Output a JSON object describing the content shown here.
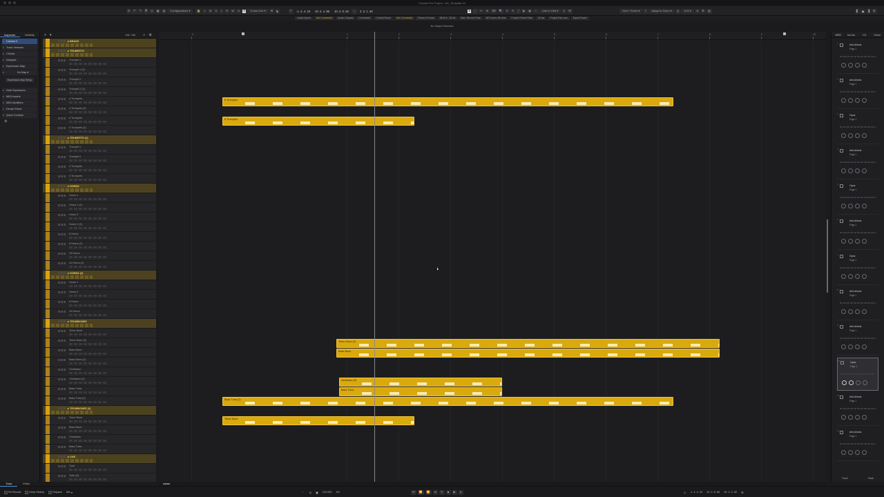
{
  "window": {
    "title": "Cubase Pro Project - AG_Template 04"
  },
  "toolbar": {
    "configurations_label": "Configurations",
    "crossfade_label": "Cross-Ove",
    "position_left": "-1. 4. 4. 23",
    "position_mid": "10. 2. 4. 85",
    "position_end": "10. 2. 0. 62",
    "length": "2. 3. 1. 40",
    "snap_label": "Link to Grid",
    "grid_label": "Grid + Event",
    "zoom_label": "Adapt to Zoom",
    "quantize": "1/16"
  },
  "status": {
    "items": [
      {
        "label": "Audio Inputs",
        "warn": false
      },
      {
        "label": "Not Connected",
        "warn": true
      },
      {
        "label": "Audio Outputs",
        "warn": false
      },
      {
        "label": "Connected",
        "warn": false
      },
      {
        "label": "Control Room",
        "warn": false
      },
      {
        "label": "Not Connected",
        "warn": true
      },
      {
        "label": "Record Format",
        "warn": false
      },
      {
        "label": "48 kHz - 32 bit",
        "warn": false
      },
      {
        "label": "Max. Record Time",
        "warn": false
      },
      {
        "label": "687 hours 48 mins",
        "warn": false
      },
      {
        "label": "Project Frame Rate",
        "warn": false
      },
      {
        "label": "30 fps",
        "warn": false
      },
      {
        "label": "Project Pan Law",
        "warn": false
      },
      {
        "label": "Equal Power",
        "warn": false
      }
    ],
    "info_line": "No Object Selected"
  },
  "inspector": {
    "tabs": [
      "Inspector",
      "Visibility"
    ],
    "sections": [
      {
        "label": "Clarinet 3",
        "highlight": true
      },
      {
        "label": "Track Versions",
        "highlight": false
      },
      {
        "label": "Chords",
        "highlight": false
      },
      {
        "label": "Notepad",
        "highlight": false
      },
      {
        "label": "Expression Map",
        "highlight": false
      }
    ],
    "no_map": "No Map",
    "setup_button": "Expression Map Setup",
    "sections2": [
      {
        "label": "Note Expression"
      },
      {
        "label": "MIDI Inserts"
      },
      {
        "label": "MIDI Modifiers"
      },
      {
        "label": "Device Panel"
      },
      {
        "label": "Quick Controls"
      }
    ]
  },
  "tracklist": {
    "count": "106 / 106",
    "tracks": [
      {
        "name": "BRASS",
        "folder": true
      },
      {
        "name": "TRUMPETS",
        "folder": true
      },
      {
        "name": "Trumpet 1",
        "folder": false
      },
      {
        "name": "Trumpet 1 (2)",
        "folder": false
      },
      {
        "name": "Trumpet 2",
        "folder": false
      },
      {
        "name": "Trumpet 2 (2)",
        "folder": false
      },
      {
        "name": "4 Trumpets",
        "folder": false
      },
      {
        "name": "4 Trumpets (2)",
        "folder": false
      },
      {
        "name": "6 Trumpets",
        "folder": false
      },
      {
        "name": "6 Trumpets (2)",
        "folder": false
      },
      {
        "name": "TRUMPETS (2)",
        "folder": true
      },
      {
        "name": "Trumpet 1",
        "folder": false
      },
      {
        "name": "Trumpet 2",
        "folder": false
      },
      {
        "name": "4 Trumpets",
        "folder": false
      },
      {
        "name": "6 Trumpets",
        "folder": false
      },
      {
        "name": "HORNS",
        "folder": true
      },
      {
        "name": "Horns 1",
        "folder": false
      },
      {
        "name": "Horns 1 (2)",
        "folder": false
      },
      {
        "name": "Horns 2",
        "folder": false
      },
      {
        "name": "Horns 2 (2)",
        "folder": false
      },
      {
        "name": "6 Horns",
        "folder": false
      },
      {
        "name": "6 Horns (2)",
        "folder": false
      },
      {
        "name": "10 Horns",
        "folder": false
      },
      {
        "name": "10 Horns (2)",
        "folder": false
      },
      {
        "name": "HORNS (2)",
        "folder": true
      },
      {
        "name": "Horns 1",
        "folder": false
      },
      {
        "name": "Horns 2",
        "folder": false
      },
      {
        "name": "6 Horns",
        "folder": false
      },
      {
        "name": "10 Horns",
        "folder": false
      },
      {
        "name": "TROMBONES",
        "folder": true
      },
      {
        "name": "Tenor Bone",
        "folder": false
      },
      {
        "name": "Tenor Bone (2)",
        "folder": false
      },
      {
        "name": "Bass Bone",
        "folder": false
      },
      {
        "name": "Bass Bone (2)",
        "folder": false
      },
      {
        "name": "Cimbasso",
        "folder": false
      },
      {
        "name": "Cimbasso (2)",
        "folder": false
      },
      {
        "name": "Bass Tuba",
        "folder": false
      },
      {
        "name": "Bass Tuba (2)",
        "folder": false
      },
      {
        "name": "TROMBONES (2)",
        "folder": true
      },
      {
        "name": "Tenor Bone",
        "folder": false
      },
      {
        "name": "Bass Bone",
        "folder": false
      },
      {
        "name": "Cimbasso",
        "folder": false
      },
      {
        "name": "Bass Tuba",
        "folder": false
      },
      {
        "name": "LWS",
        "folder": true
      },
      {
        "name": "Tuab",
        "folder": false
      },
      {
        "name": "Tuab (2)",
        "folder": false
      }
    ]
  },
  "arrangement": {
    "ruler": [
      "-2",
      "1",
      "2",
      "3",
      "4",
      "5",
      "6",
      "7",
      "8",
      "9",
      "10"
    ],
    "regions": [
      {
        "name": "6 Trumpets",
        "track": 6,
        "start_bar": -1.4,
        "end_bar": 7.3
      },
      {
        "name": "6 Trumpets",
        "track": 8,
        "start_bar": -1.4,
        "end_bar": 2.3
      },
      {
        "name": "Tenor Bone (2)",
        "track": 31,
        "start_bar": 0.8,
        "end_bar": 8.2
      },
      {
        "name": "Bass Bone",
        "track": 32,
        "start_bar": 0.8,
        "end_bar": 8.2
      },
      {
        "name": "Cimbasso (2)",
        "track": 35,
        "start_bar": 0.85,
        "end_bar": 4.0
      },
      {
        "name": "Bass Tuba",
        "track": 36,
        "start_bar": 0.85,
        "end_bar": 4.0
      },
      {
        "name": "Bass Tuba (2)",
        "track": 37,
        "start_bar": -1.4,
        "end_bar": 7.3
      },
      {
        "name": "Tenor Bone",
        "track": 39,
        "start_bar": -1.4,
        "end_bar": 2.3
      }
    ]
  },
  "rack": {
    "tabs": [
      "VSTi",
      "Media",
      "CR",
      "Meter"
    ],
    "instruments": [
      {
        "name": "Arts Arturia",
        "page": "Page 1"
      },
      {
        "name": "Arts Arturia",
        "page": "Page 1"
      },
      {
        "name": "Opus",
        "page": "Page 1"
      },
      {
        "name": "Arts Arturia",
        "page": "Page 1"
      },
      {
        "name": "Opus",
        "page": "Page 1"
      },
      {
        "name": "Arts Arturia",
        "page": "Page 1"
      },
      {
        "name": "Opus",
        "page": "Page 1"
      },
      {
        "name": "Arts Arturia",
        "page": "Page 1"
      },
      {
        "name": "Arts Arturia",
        "page": "Page 1"
      },
      {
        "name": "Opus",
        "page": "Page 1"
      },
      {
        "name": "Arts Arturia",
        "page": "Page 1"
      },
      {
        "name": "Arts Arturia",
        "page": "Page 1"
      }
    ],
    "footer_left": "Track",
    "footer_right": "Rack"
  },
  "footer": {
    "tabs": [
      "Track",
      "Editor"
    ],
    "record_mode": "Re-Record",
    "keep_history": "Keep History",
    "replace": "Replace",
    "mix": "Mix",
    "tempo": "120.000",
    "signature": "4/4",
    "pos1": "-1. 4. 4. 23",
    "pos2": "10. 2. 8. 85",
    "pos3": "10. 2. 0. 62"
  }
}
